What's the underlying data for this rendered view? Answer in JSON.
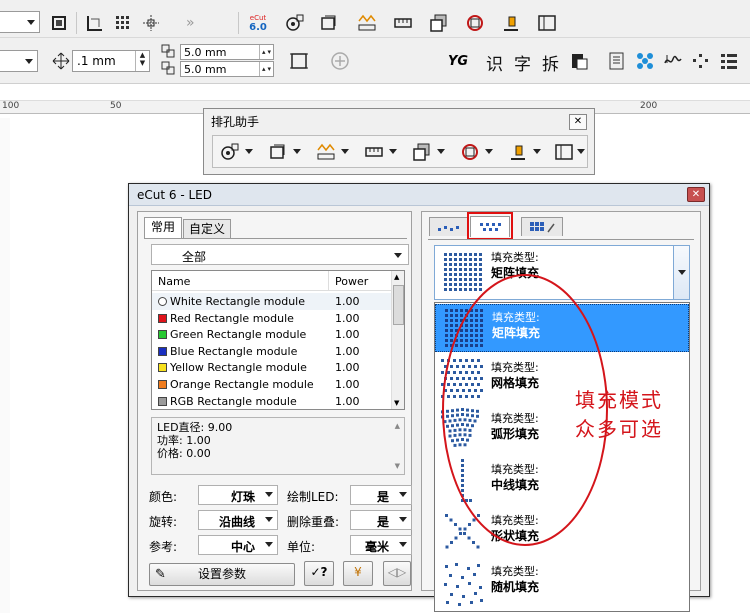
{
  "toolbar": {
    "nudge_value": ".1 mm",
    "dup_x": "5.0 mm",
    "dup_y": "5.0 mm",
    "chars": [
      "识",
      "字",
      "拆"
    ],
    "ecut_badge": "6.0",
    "ecut_label": "eCut"
  },
  "ruler": {
    "labels": [
      "100",
      "50",
      "200"
    ]
  },
  "punch_assistant": {
    "title": "排孔助手"
  },
  "dialog": {
    "title": "eCut 6 - LED",
    "tabs": [
      "常用",
      "自定义"
    ],
    "category": "全部",
    "table": {
      "columns": [
        "Name",
        "Power"
      ],
      "rows": [
        {
          "name": "White Rectangle module",
          "power": "1.00",
          "color": "#ffffff"
        },
        {
          "name": "Red Rectangle module",
          "power": "1.00",
          "color": "#e0141b"
        },
        {
          "name": "Green Rectangle module",
          "power": "1.00",
          "color": "#28c832"
        },
        {
          "name": "Blue Rectangle module",
          "power": "1.00",
          "color": "#1a2fc0"
        },
        {
          "name": "Yellow Rectangle module",
          "power": "1.00",
          "color": "#f7e11e"
        },
        {
          "name": "Orange Rectangle module",
          "power": "1.00",
          "color": "#f07c1e"
        },
        {
          "name": "RGB Rectangle module",
          "power": "1.00",
          "color": "#9b9b9b"
        }
      ]
    },
    "info": {
      "diameter": "LED直径: 9.00",
      "power": "功率: 1.00",
      "price": "价格: 0.00"
    },
    "settings": [
      {
        "label": "颜色:",
        "value": "灯珠"
      },
      {
        "label": "绘制LED:",
        "value": "是"
      },
      {
        "label": "旋转:",
        "value": "沿曲线"
      },
      {
        "label": "删除重叠:",
        "value": "是"
      },
      {
        "label": "参考:",
        "value": "中心"
      },
      {
        "label": "单位:",
        "value": "毫米"
      }
    ],
    "set_params_label": "设置参数"
  },
  "fill_selector": {
    "selected": {
      "type_label": "填充类型:",
      "type_value": "矩阵填充"
    },
    "options": [
      {
        "type_label": "填充类型:",
        "type_value": "矩阵填充"
      },
      {
        "type_label": "填充类型:",
        "type_value": "网格填充"
      },
      {
        "type_label": "填充类型:",
        "type_value": "弧形填充"
      },
      {
        "type_label": "填充类型:",
        "type_value": "中线填充"
      },
      {
        "type_label": "填充类型:",
        "type_value": "形状填充"
      },
      {
        "type_label": "填充类型:",
        "type_value": "随机填充"
      }
    ]
  },
  "annotation": {
    "line1": "填充模式",
    "line2": "众多可选",
    "color": "#d4151b"
  },
  "colors": {
    "selection": "#3399ff",
    "annotation_red": "#d4151b"
  }
}
